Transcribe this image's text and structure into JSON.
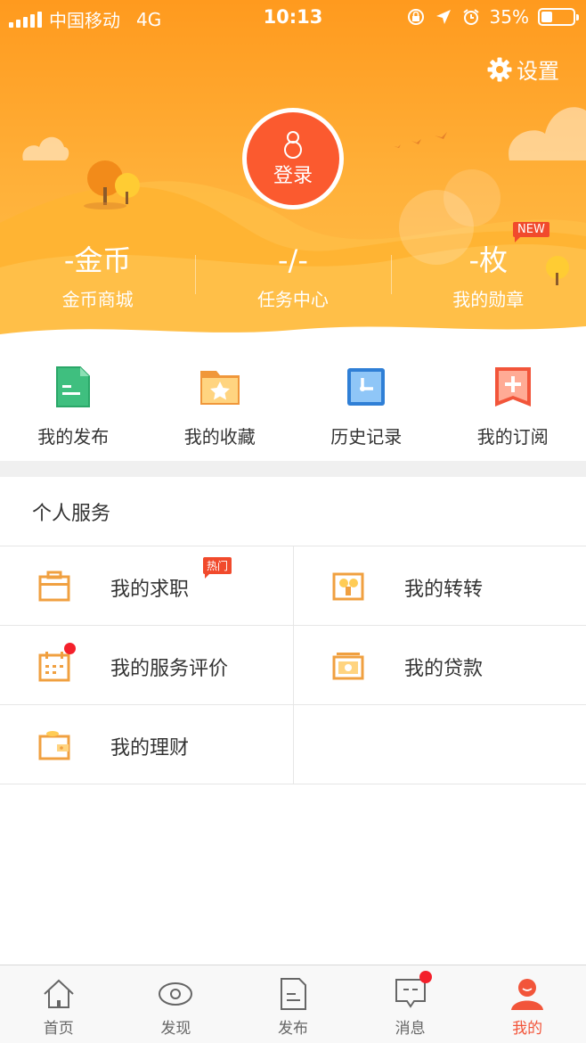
{
  "statusbar": {
    "carrier": "中国移动",
    "network": "4G",
    "time": "10:13",
    "battery": "35%",
    "battery_level": 0.35
  },
  "header": {
    "settings_label": "设置",
    "login_label": "登录",
    "new_badge": "NEW",
    "stats": [
      {
        "value": "-金币",
        "label": "金币商城"
      },
      {
        "value": "-/-",
        "label": "任务中心"
      },
      {
        "value": "-枚",
        "label": "我的勋章"
      }
    ]
  },
  "quick_actions": [
    {
      "label": "我的发布",
      "icon": "document-icon",
      "color": "#3fbf7f"
    },
    {
      "label": "我的收藏",
      "icon": "star-folder-icon",
      "color": "#f5a442"
    },
    {
      "label": "历史记录",
      "icon": "clock-icon",
      "color": "#3d8de0"
    },
    {
      "label": "我的订阅",
      "icon": "plus-bookmark-icon",
      "color": "#f2553a"
    }
  ],
  "services": {
    "title": "个人服务",
    "hot_badge": "热门",
    "items": [
      {
        "label": "我的求职",
        "icon": "briefcase-icon"
      },
      {
        "label": "我的转转",
        "icon": "exchange-icon"
      },
      {
        "label": "我的服务评价",
        "icon": "calendar-icon"
      },
      {
        "label": "我的贷款",
        "icon": "cash-icon"
      },
      {
        "label": "我的理财",
        "icon": "wallet-icon"
      }
    ]
  },
  "tabbar": [
    {
      "label": "首页",
      "icon": "home-icon"
    },
    {
      "label": "发现",
      "icon": "eye-icon"
    },
    {
      "label": "发布",
      "icon": "edit-document-icon"
    },
    {
      "label": "消息",
      "icon": "message-icon"
    },
    {
      "label": "我的",
      "icon": "user-icon"
    }
  ],
  "colors": {
    "accent": "#f2553a",
    "header_orange": "#ffa62b",
    "icon_orange": "#f0a040"
  }
}
